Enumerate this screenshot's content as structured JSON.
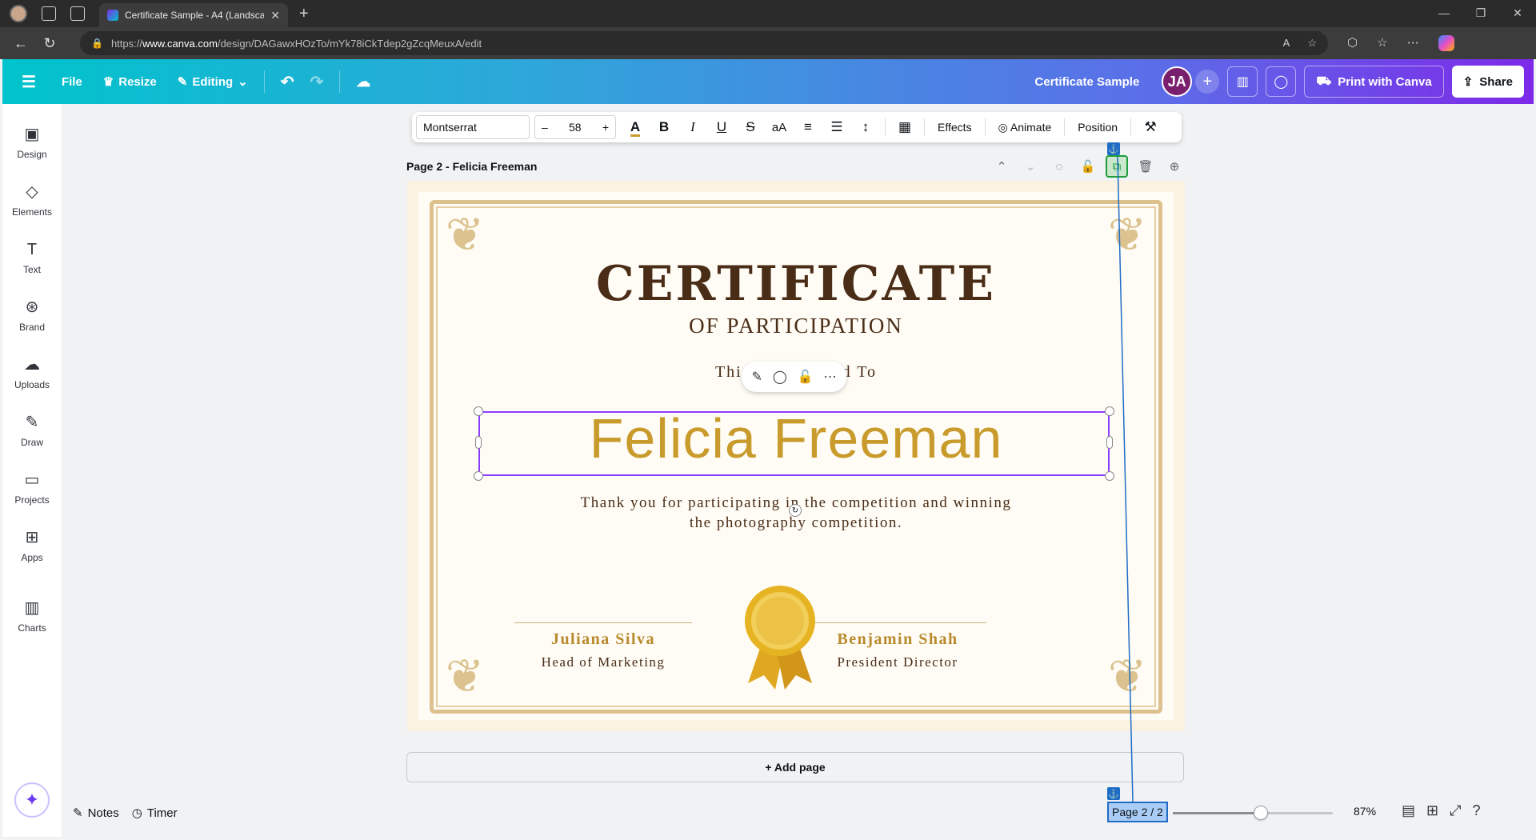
{
  "browser": {
    "tab_title": "Certificate Sample - A4 (Landscap",
    "url_prefix": "https://",
    "url_domain": "www.canva.com",
    "url_path": "/design/DAGawxHOzTo/mYk78iCkTdep2gZcqMeuxA/edit"
  },
  "header": {
    "file_label": "File",
    "resize_label": "Resize",
    "editing_label": "Editing",
    "doc_title": "Certificate Sample",
    "avatar_initials": "JA",
    "print_label": "Print with Canva",
    "share_label": "Share"
  },
  "sidebar": {
    "items": [
      {
        "label": "Design",
        "icon": "design-icon"
      },
      {
        "label": "Elements",
        "icon": "elements-icon"
      },
      {
        "label": "Text",
        "icon": "text-icon"
      },
      {
        "label": "Brand",
        "icon": "brand-icon"
      },
      {
        "label": "Uploads",
        "icon": "uploads-icon"
      },
      {
        "label": "Draw",
        "icon": "draw-icon"
      },
      {
        "label": "Projects",
        "icon": "projects-icon"
      },
      {
        "label": "Apps",
        "icon": "apps-icon"
      },
      {
        "label": "Charts",
        "icon": "charts-icon"
      }
    ]
  },
  "toolbar": {
    "font": "Montserrat",
    "font_size": "58",
    "effects_label": "Effects",
    "animate_label": "Animate",
    "position_label": "Position",
    "text_color": "#c89b2e"
  },
  "page": {
    "header_label": "Page 2 - Felicia Freeman"
  },
  "certificate": {
    "title": "CERTIFICATE",
    "subtitle": "OF PARTICIPATION",
    "presented": "This Certi        sented To",
    "recipient": "Felicia Freeman",
    "message_line1": "Thank you for participating in the competition and winning",
    "message_line2": "the photography competition.",
    "signer1_name": "Juliana Silva",
    "signer1_role": "Head of Marketing",
    "signer2_name": "Benjamin Shah",
    "signer2_role": "President Director"
  },
  "add_page_label": "+ Add page",
  "bottom": {
    "notes_label": "Notes",
    "timer_label": "Timer",
    "page_indicator": "Page 2 / 2",
    "zoom": "87%",
    "zoom_fraction": 0.55
  },
  "colors": {
    "accent": "#8b3dff",
    "gold": "#c99b2c",
    "brown": "#4a2d17"
  }
}
